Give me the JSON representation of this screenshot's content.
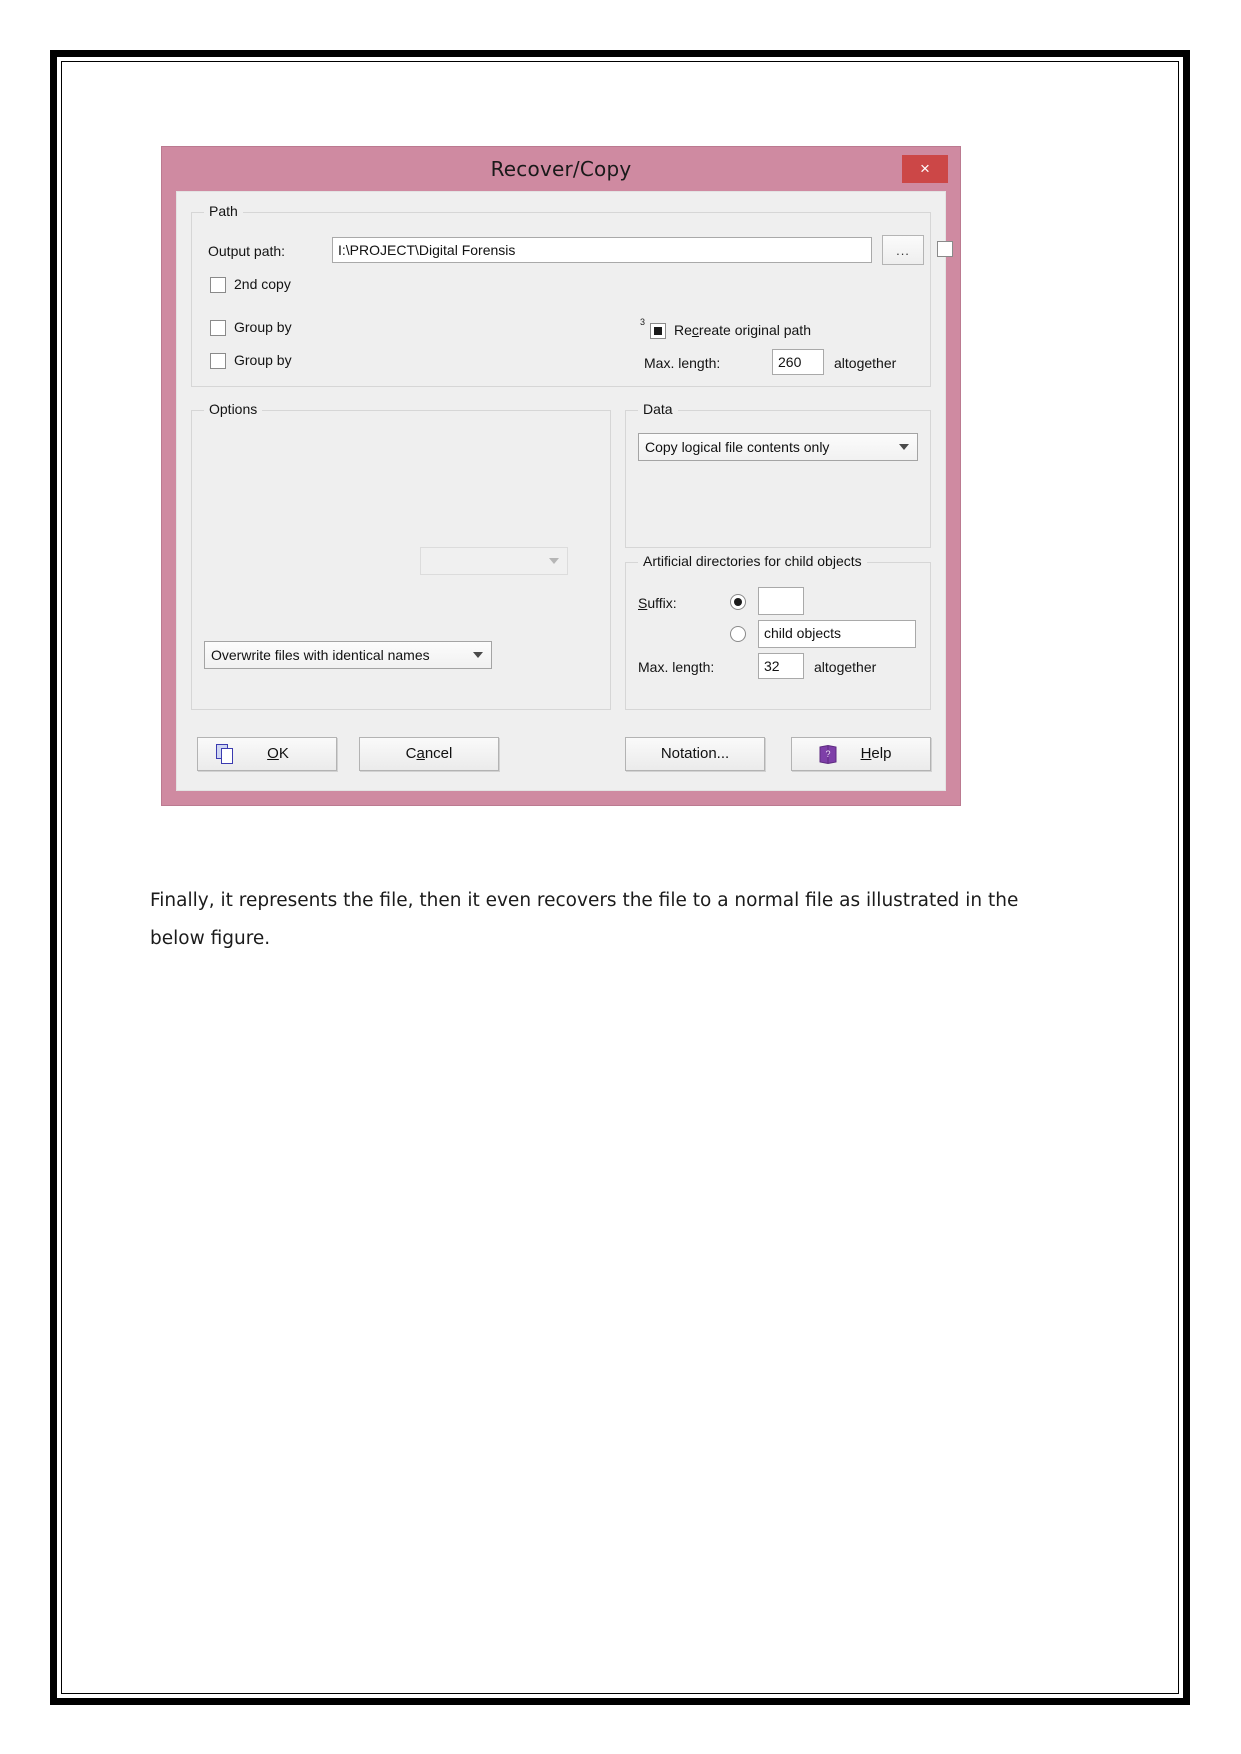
{
  "document": {
    "paragraph": "Finally, it represents the file, then it even recovers the file to a normal file as illustrated in the below figure."
  },
  "dialog": {
    "title": "Recover/Copy",
    "close_label": "×",
    "colors": {
      "titlebar": "#cf8aa1",
      "close_button": "#cc4747",
      "body": "#efefef"
    },
    "path_group": {
      "legend": "Path",
      "output_label": "Output path:",
      "output_value": "I:\\PROJECT\\Digital Forensis",
      "output_placeholder": "Output path",
      "browse_label": "...",
      "browse_checkbox_checked": "false",
      "second_copy_label": "2nd copy",
      "group_by_1_label": "Group by",
      "group_by_2_label": "Group by",
      "recreate_superscript": "3",
      "recreate_label_pre": "Re",
      "recreate_label_underlined": "c",
      "recreate_label_post": "reate original path",
      "max_length_label": "Max. length:",
      "max_length_value": "260",
      "altogether_label": "altogether"
    },
    "options_group": {
      "legend": "Options",
      "empty_combo_value": "",
      "empty_combo_placeholder": "",
      "overwrite_combo_value": "Overwrite files with identical names"
    },
    "data_group": {
      "legend": "Data",
      "combo_value": "Copy logical file contents only"
    },
    "artificial_group": {
      "legend": "Artificial directories for child objects",
      "suffix_label_underlined": "S",
      "suffix_label_rest": "uffix:",
      "suffix_radio_selected": "true",
      "suffix_value": "",
      "child_radio_selected": "false",
      "child_value": "child objects",
      "max_length_label": "Max. length:",
      "max_length_value": "32",
      "altogether_label": "altogether"
    },
    "buttons": {
      "ok_underlined": "O",
      "ok_rest": "K",
      "cancel_pre": "C",
      "cancel_underlined": "a",
      "cancel_post": "ncel",
      "notation": "Notation...",
      "help_underlined": "H",
      "help_rest": "elp"
    }
  }
}
